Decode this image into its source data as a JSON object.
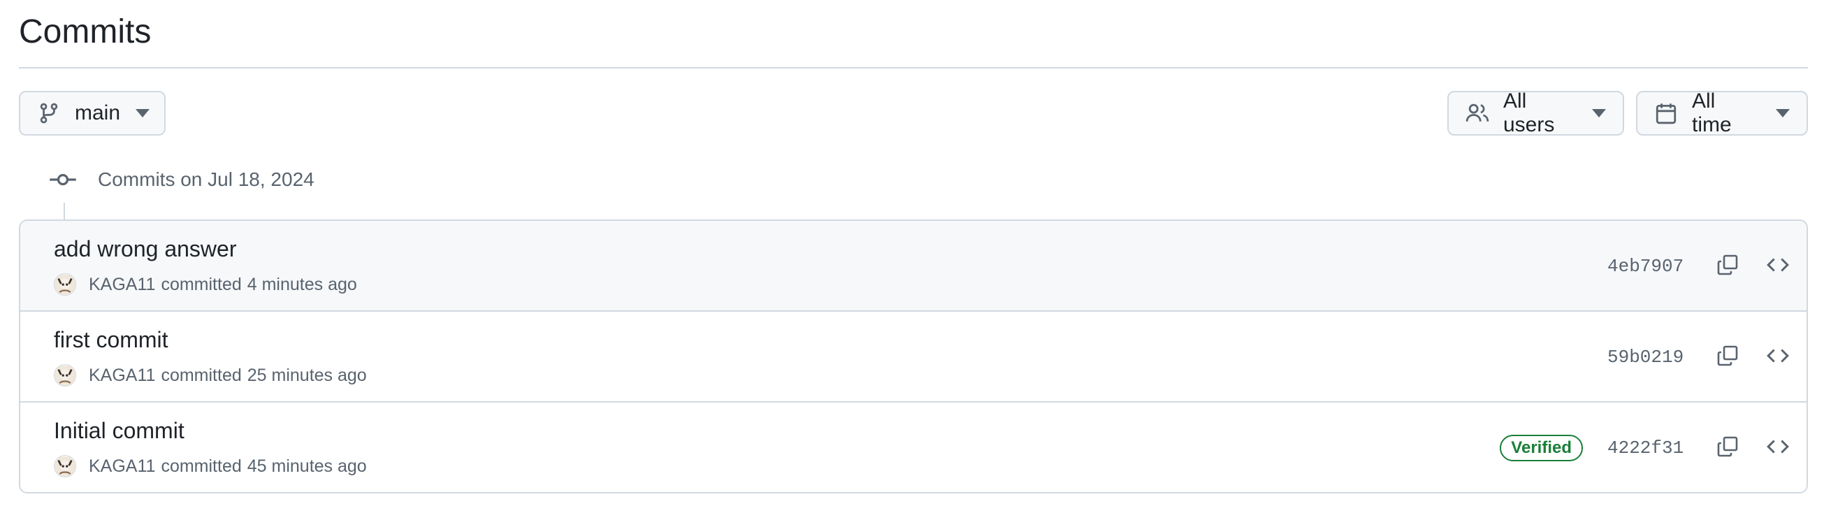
{
  "page": {
    "title": "Commits"
  },
  "filters": {
    "branch": {
      "label": "main",
      "icon": "git-branch-icon"
    },
    "users": {
      "label": "All users",
      "icon": "people-icon"
    },
    "time": {
      "label": "All time",
      "icon": "calendar-icon"
    }
  },
  "group": {
    "heading": "Commits on Jul 18, 2024",
    "icon": "git-commit-icon"
  },
  "commits": [
    {
      "title": "add wrong answer",
      "author": "KAGA11",
      "verb": "committed",
      "time": "4 minutes ago",
      "sha": "4eb7907",
      "verified": null
    },
    {
      "title": "first commit",
      "author": "KAGA11",
      "verb": "committed",
      "time": "25 minutes ago",
      "sha": "59b0219",
      "verified": null
    },
    {
      "title": "Initial commit",
      "author": "KAGA11",
      "verb": "committed",
      "time": "45 minutes ago",
      "sha": "4222f31",
      "verified": "Verified"
    }
  ],
  "colors": {
    "border": "#d1d9e0",
    "muted_text": "#59636e",
    "verified_green": "#1a7f37",
    "button_bg": "#f6f8fa"
  }
}
